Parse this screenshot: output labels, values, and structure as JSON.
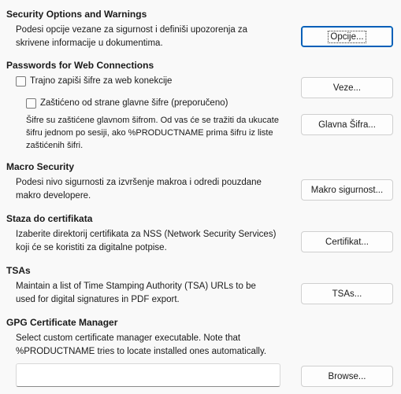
{
  "security_options": {
    "heading": "Security Options and Warnings",
    "desc_line1": "Podesi opcije vezane za sigurnost i definiši upozorenja za",
    "desc_line2": "skrivene informacije u dokumentima.",
    "button_label": "Opcije..."
  },
  "passwords": {
    "heading": "Passwords for Web Connections",
    "persist_checkbox_label": "Trajno zapiši šifre za web konekcije",
    "persist_checked": false,
    "master_checkbox_label": "Zaštićeno od strane glavne šifre (preporučeno)",
    "master_checked": false,
    "note_line1": "Šifre su zaštićene glavnom šifrom. Od vas će se tražiti da ukucate",
    "note_line2": "šifru jednom po sesiji, ako %PRODUCTNAME prima šifru iz liste",
    "note_line3": "zaštićenih šifri.",
    "connections_button": "Veze...",
    "master_button": "Glavna Šifra..."
  },
  "macro_security": {
    "heading": "Macro Security",
    "desc_line1": "Podesi nivo sigurnosti za izvršenje makroa i odredi pouzdane",
    "desc_line2": "makro developere.",
    "button_label": "Makro sigurnost..."
  },
  "certificate_path": {
    "heading": "Staza do certifikata",
    "desc_line1": "Izaberite direktorij certifikata za NSS (Network Security Services)",
    "desc_line2": "koji će se koristiti za digitalne potpise.",
    "button_label": "Certifikat..."
  },
  "tsas": {
    "heading": "TSAs",
    "desc_line1": "Maintain a list of Time Stamping Authority (TSA) URLs to be",
    "desc_line2": "used for digital signatures in PDF export.",
    "button_label": "TSAs..."
  },
  "gpg": {
    "heading": "GPG Certificate Manager",
    "desc_line1": "Select custom certificate manager executable. Note that",
    "desc_line2": "%PRODUCTNAME tries to locate installed ones automatically.",
    "path_value": "",
    "button_label": "Browse..."
  }
}
